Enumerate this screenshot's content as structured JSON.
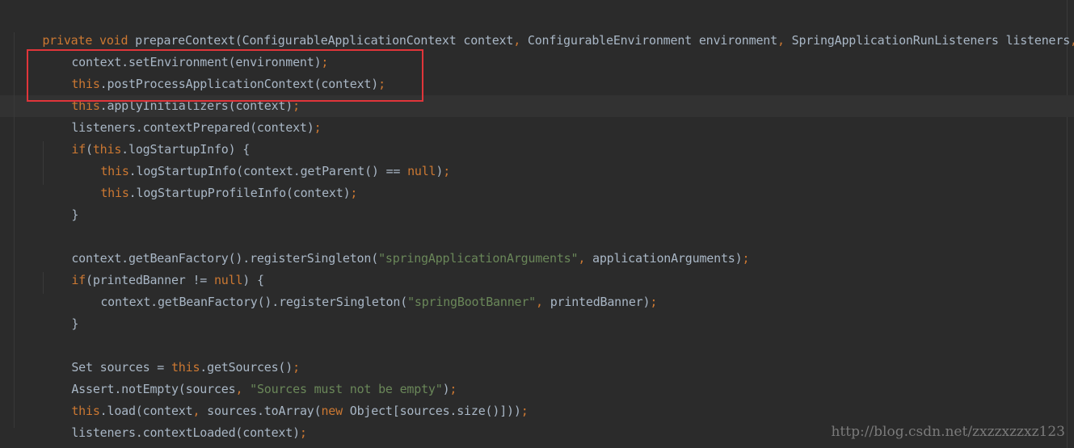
{
  "editor": {
    "lines": [
      [
        "private",
        " ",
        "void",
        " prepareContext(ConfigurableApplicationContext context",
        ",",
        " ConfigurableEnvironment environment",
        ",",
        " SpringApplicationRunListeners listeners",
        ","
      ],
      [
        "context.setEnvironment(environment)",
        ";"
      ],
      [
        "this",
        ".postProcessApplicationContext(context)",
        ";"
      ],
      [
        "this",
        ".applyInitializers(context)",
        ";"
      ],
      [
        "listeners.contextPrepared(context)",
        ";"
      ],
      [
        "if",
        "(",
        "this",
        ".logStartupInfo) {"
      ],
      [
        "this",
        ".logStartupInfo(context.getParent() == ",
        "null",
        ")",
        ";"
      ],
      [
        "this",
        ".logStartupProfileInfo(context)",
        ";"
      ],
      [
        "}"
      ],
      [
        "context.getBeanFactory().registerSingleton(",
        "\"springApplicationArguments\"",
        ",",
        " applicationArguments)",
        ";"
      ],
      [
        "if",
        "(printedBanner != ",
        "null",
        ") {"
      ],
      [
        "context.getBeanFactory().registerSingleton(",
        "\"springBootBanner\"",
        ",",
        " printedBanner)",
        ";"
      ],
      [
        "}"
      ],
      [
        "Set sources = ",
        "this",
        ".getSources()",
        ";"
      ],
      [
        "Assert.notEmpty(sources",
        ",",
        " ",
        "\"Sources must not be empty\"",
        ")",
        ";"
      ],
      [
        "this",
        ".load(context",
        ",",
        " sources.toArray(",
        "new",
        " Object[sources.size()]))",
        ";"
      ],
      [
        "listeners.contextLoaded(context)",
        ";"
      ],
      [
        "}"
      ]
    ]
  },
  "watermark": "http://blog.csdn.net/zxzzxzzxz123",
  "colors": {
    "background": "#2b2b2b",
    "keyword": "#cc7832",
    "string": "#6a8759",
    "text": "#a9b7c6",
    "highlight_border": "#e0353a"
  }
}
